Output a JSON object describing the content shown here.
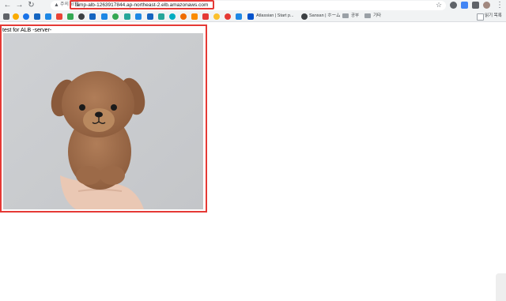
{
  "toolbar": {
    "back_icon": "back-arrow-icon",
    "forward_icon": "forward-arrow-icon",
    "reload_icon": "reload-icon",
    "security_warning": "주의 요함",
    "url": "lamp-alb-1263917844.ap-northeast-2.elb.amazonaws.com"
  },
  "bookmarks": {
    "items": [
      {
        "label": "Atlassian | Start p..."
      },
      {
        "label": "Sansan | ホーム"
      },
      {
        "label": "공부"
      },
      {
        "label": "기타"
      }
    ],
    "reading_list": "읽기 목록"
  },
  "page": {
    "heading": "test for ALB -server-"
  },
  "colors": {
    "highlight_border": "#e53935",
    "chrome_bg": "#f1f3f4"
  }
}
